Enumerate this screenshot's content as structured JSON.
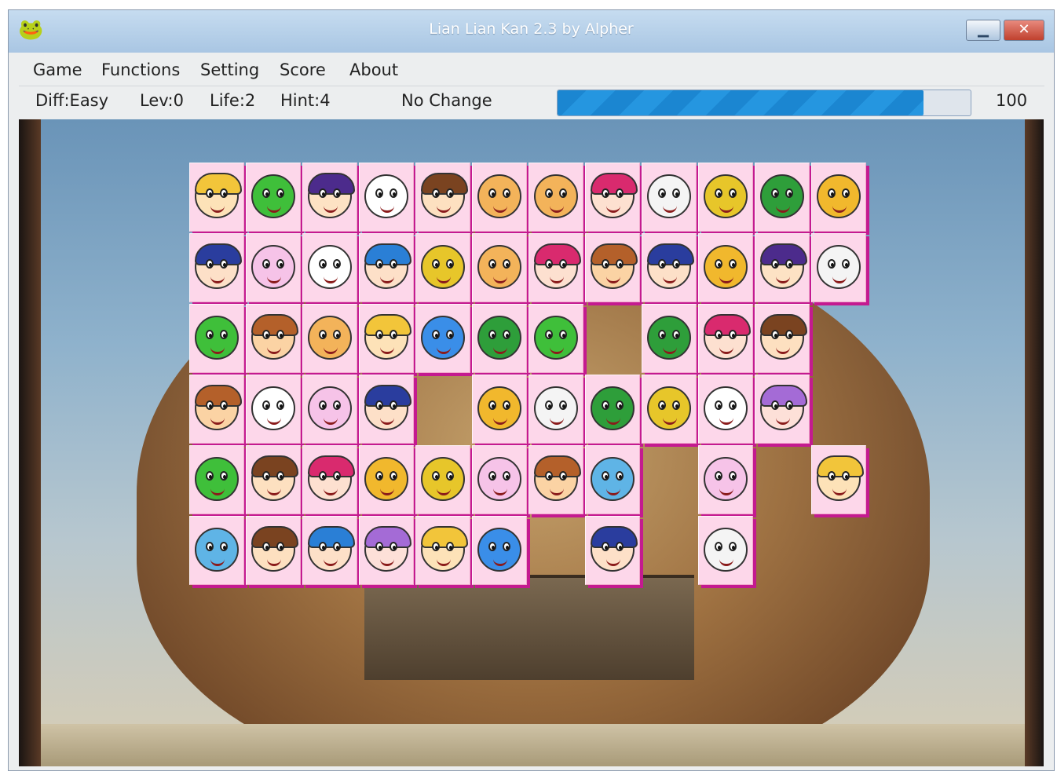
{
  "window": {
    "title": "Lian Lian Kan 2.3 by Alpher",
    "app_icon": "frog-app-icon"
  },
  "menu": [
    {
      "key": "G",
      "rest": "ame"
    },
    {
      "key": "F",
      "rest": "unctions"
    },
    {
      "key": "S",
      "rest": "etting"
    },
    {
      "key": "S",
      "pre": "S",
      "rest": "ore",
      "mid": "c"
    },
    {
      "key": "A",
      "rest": "bout"
    }
  ],
  "menu_labels": [
    "Game",
    "Functions",
    "Setting",
    "Score",
    "About"
  ],
  "status": {
    "difficulty": "Diff:Easy",
    "level": "Lev:0",
    "life": "Life:2",
    "hint": "Hint:4",
    "message": "No Change",
    "time_value": "100",
    "time_fraction": 0.885
  },
  "colors": {
    "tile_bg": "#fdd7ea",
    "tile_edge": "#c41a90",
    "progress": "#1b86d1"
  },
  "board": {
    "cols": 12,
    "rows": 6,
    "grid": [
      [
        "blonde-girl",
        "frog",
        "purple-hair-girl",
        "white-cat",
        "brown-hair-girl",
        "monkey",
        "monkey",
        "pink-hair-girl",
        "white-dog",
        "yellow-fish",
        "green-duck",
        "yellow-seal"
      ],
      [
        "blue-hair-girl",
        "pink-rabbit",
        "white-cat",
        "blue-hair-boy",
        "yellow-fish",
        "monkey",
        "pink-hair-girl",
        "brown-hair-boy",
        "blue-hair-girl",
        "yellow-seal",
        "purple-hair-girl",
        "white-dog"
      ],
      [
        "frog",
        "brown-hair-boy",
        "monkey",
        "blonde-girl",
        "blue-dog",
        "green-duck",
        "frog",
        null,
        "green-duck",
        "pink-hair-girl",
        "brown-hair-girl",
        null
      ],
      [
        "brown-hair-boy",
        "white-cat",
        "pink-rabbit",
        "blue-hair-girl",
        null,
        "yellow-seal",
        "white-dog",
        "green-duck",
        "yellow-fish",
        "white-cat",
        "lilac-hair-girl",
        null
      ],
      [
        "frog",
        "brown-hair-girl",
        "pink-hair-girl",
        "yellow-seal",
        "yellow-fish",
        "pink-rabbit",
        "brown-hair-boy",
        "dolphin",
        null,
        "pink-rabbit",
        null,
        "blonde-girl"
      ],
      [
        "dolphin",
        "brown-hair-girl",
        "blue-hair-boy",
        "lilac-hair-girl",
        "blonde-girl",
        "blue-dog",
        null,
        "blue-hair-girl",
        null,
        "white-dog",
        null,
        null
      ]
    ]
  }
}
